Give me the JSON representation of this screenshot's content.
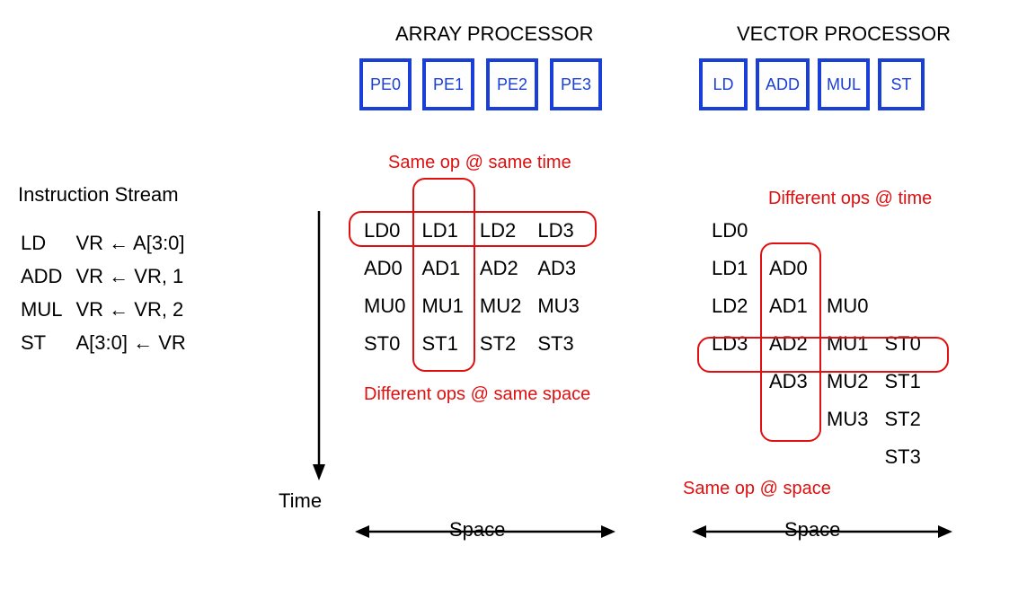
{
  "titles": {
    "array": "ARRAY PROCESSOR",
    "vector": "VECTOR PROCESSOR"
  },
  "array_units": [
    "PE0",
    "PE1",
    "PE2",
    "PE3"
  ],
  "vector_units": [
    "LD",
    "ADD",
    "MUL",
    "ST"
  ],
  "instruction_stream": {
    "heading": "Instruction Stream",
    "rows": [
      {
        "op": "LD",
        "dst": "VR",
        "arrow": "←",
        "src": "A[3:0]"
      },
      {
        "op": "ADD",
        "dst": "VR",
        "arrow": "←",
        "src": "VR, 1"
      },
      {
        "op": "MUL",
        "dst": "VR",
        "arrow": "←",
        "src": "VR, 2"
      },
      {
        "op": "ST",
        "dst": "A[3:0]",
        "arrow": "←",
        "src": "VR"
      }
    ]
  },
  "time_label": "Time",
  "space_label": "Space",
  "array_grid": [
    [
      "LD0",
      "LD1",
      "LD2",
      "LD3"
    ],
    [
      "AD0",
      "AD1",
      "AD2",
      "AD3"
    ],
    [
      "MU0",
      "MU1",
      "MU2",
      "MU3"
    ],
    [
      "ST0",
      "ST1",
      "ST2",
      "ST3"
    ]
  ],
  "vector_grid": [
    [
      "LD0",
      "",
      "",
      ""
    ],
    [
      "LD1",
      "AD0",
      "",
      ""
    ],
    [
      "LD2",
      "AD1",
      "MU0",
      ""
    ],
    [
      "LD3",
      "AD2",
      "MU1",
      "ST0"
    ],
    [
      "",
      "AD3",
      "MU2",
      "ST1"
    ],
    [
      "",
      "",
      "MU3",
      "ST2"
    ],
    [
      "",
      "",
      "",
      "ST3"
    ]
  ],
  "annotations": {
    "same_op_same_time": "Same op @ same time",
    "diff_ops_same_space": "Different ops @ same space",
    "diff_ops_time": "Different ops @ time",
    "same_op_space": "Same op @ space"
  }
}
